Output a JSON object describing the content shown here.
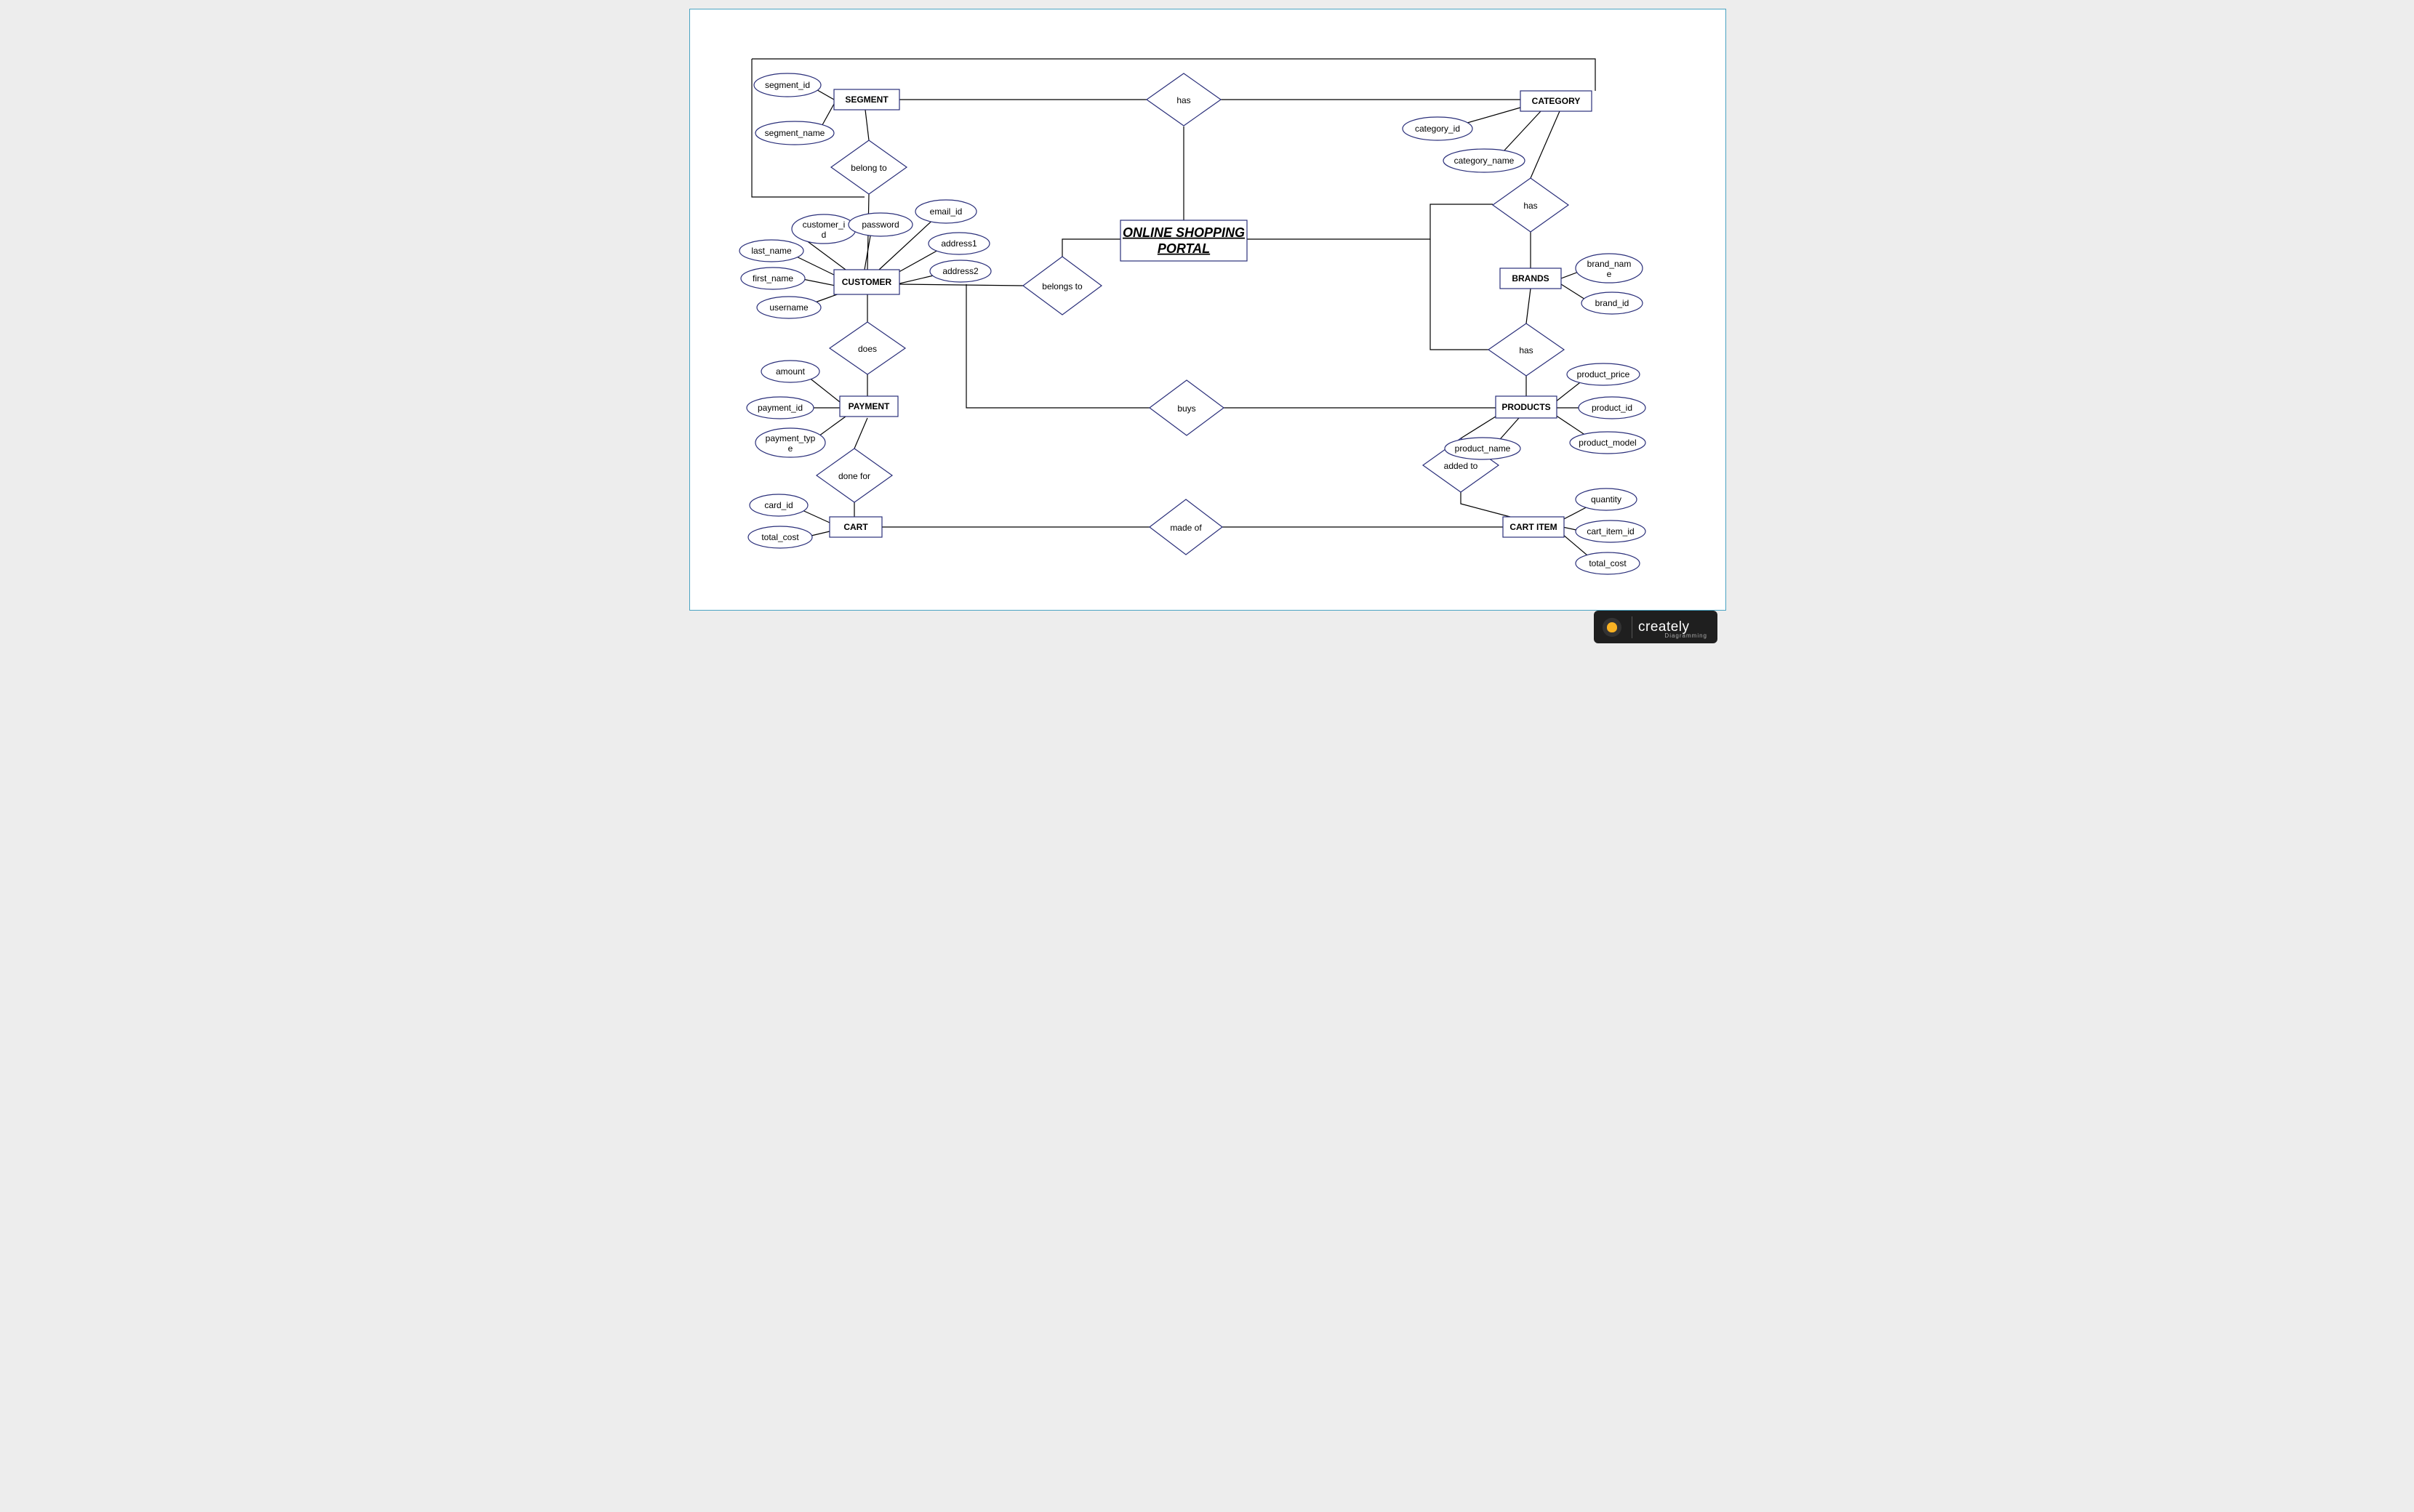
{
  "title_line1": "ONLINE SHOPPING",
  "title_line2": "PORTAL",
  "entities": {
    "segment": "SEGMENT",
    "category": "CATEGORY",
    "customer": "CUSTOMER",
    "brands": "BRANDS",
    "payment": "PAYMENT",
    "products": "PRODUCTS",
    "cart": "CART",
    "cart_item": "CART ITEM"
  },
  "relationships": {
    "has_top": "has",
    "belong_to": "belong to",
    "has_cat_brand": "has",
    "belongs_to": "belongs to",
    "does": "does",
    "has_brand_prod": "has",
    "buys": "buys",
    "done_for": "done for",
    "added_to": "added to",
    "made_of": "made of"
  },
  "attributes": {
    "segment_id": "segment_id",
    "segment_name": "segment_name",
    "category_id": "category_id",
    "category_name": "category_name",
    "customer_id_1": "customer_i",
    "customer_id_2": "d",
    "password": "password",
    "email_id": "email_id",
    "last_name": "last_name",
    "address1": "address1",
    "first_name": "first_name",
    "address2": "address2",
    "username": "username",
    "brand_name_1": "brand_nam",
    "brand_name_2": "e",
    "brand_id": "brand_id",
    "amount": "amount",
    "payment_id": "payment_id",
    "payment_type_1": "payment_typ",
    "payment_type_2": "e",
    "product_price": "product_price",
    "product_id": "product_id",
    "product_model": "product_model",
    "product_name": "product_name",
    "card_id": "card_id",
    "total_cost": "total_cost",
    "quantity": "quantity",
    "cart_item_id": "cart_item_id",
    "total_cost2": "total_cost"
  },
  "logo": {
    "name": "creately",
    "sub": "Diagramming"
  }
}
